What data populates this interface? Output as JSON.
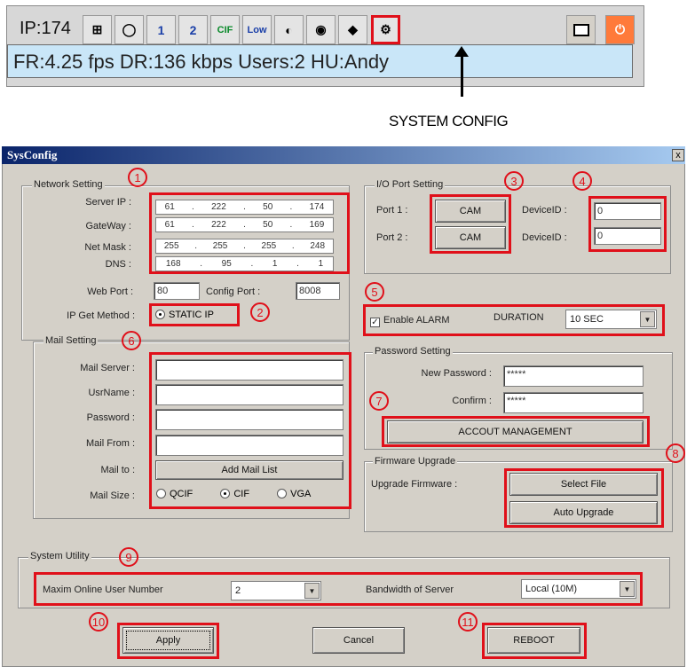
{
  "toolbar": {
    "ip_label": "IP:174",
    "status_text": "FR:4.25 fps   DR:136 kbps   Users:2  HU:Andy",
    "buttons": [
      "network-icon",
      "disc-icon",
      "layout-1-icon",
      "layout-2-icon",
      "cif-icon",
      "low-icon",
      "contrast-icon",
      "snapshot-icon",
      "tag-icon",
      "system-config-icon"
    ],
    "btn_text": {
      "b1": "1",
      "b2": "2",
      "cif": "CIF",
      "low": "Low"
    },
    "callout": "SYSTEM CONFIG"
  },
  "dialog": {
    "title": "SysConfig",
    "close": "x",
    "network": {
      "group": "Network Setting",
      "server_ip_label": "Server IP :",
      "gateway_label": "GateWay :",
      "netmask_label": "Net Mask :",
      "dns_label": "DNS :",
      "server_ip": [
        "61",
        "222",
        "50",
        "174"
      ],
      "gateway": [
        "61",
        "222",
        "50",
        "169"
      ],
      "netmask": [
        "255",
        "255",
        "255",
        "248"
      ],
      "dns": [
        "168",
        "95",
        "1",
        "1"
      ],
      "web_port_label": "Web Port :",
      "web_port": "80",
      "config_port_label": "Config Port :",
      "config_port": "8008",
      "ip_method_label": "IP Get Method :",
      "ip_method": "STATIC IP"
    },
    "mail": {
      "group": "Mail Setting",
      "server_label": "Mail Server :",
      "user_label": "UsrName :",
      "password_label": "Password :",
      "from_label": "Mail From :",
      "to_label": "Mail to :",
      "add_list": "Add Mail List",
      "size_label": "Mail Size :",
      "sizes": [
        "QCIF",
        "CIF",
        "VGA"
      ],
      "selected_size": "CIF"
    },
    "io": {
      "group": "I/O Port Setting",
      "port1_label": "Port 1 :",
      "port2_label": "Port 2 :",
      "port1": "CAM",
      "port2": "CAM",
      "device_label": "DeviceID :",
      "device1": "0",
      "device2": "0"
    },
    "alarm": {
      "enable_label": "Enable ALARM",
      "duration_label": "DURATION",
      "duration": "10 SEC",
      "checked_mark": "✓"
    },
    "password": {
      "group": "Password Setting",
      "new_label": "New Password :",
      "confirm_label": "Confirm :",
      "new_value": "*****",
      "confirm_value": "*****",
      "account_button": "ACCOUT MANAGEMENT"
    },
    "firmware": {
      "group": "Firmware Upgrade",
      "label": "Upgrade Firmware :",
      "select_file": "Select File",
      "auto_upgrade": "Auto Upgrade"
    },
    "system": {
      "group": "System Utility",
      "max_users_label": "Maxim Online User Number",
      "max_users": "2",
      "bandwidth_label": "Bandwidth of Server",
      "bandwidth": "Local (10M)"
    },
    "apply": "Apply",
    "cancel": "Cancel",
    "reboot": "REBOOT"
  },
  "annotations": [
    "1",
    "2",
    "3",
    "4",
    "5",
    "6",
    "7",
    "8",
    "9",
    "10",
    "11"
  ],
  "colors": {
    "highlight": "#e0101a",
    "status_bg": "#c9e6f8",
    "dialog_bg": "#d4d0c8"
  }
}
